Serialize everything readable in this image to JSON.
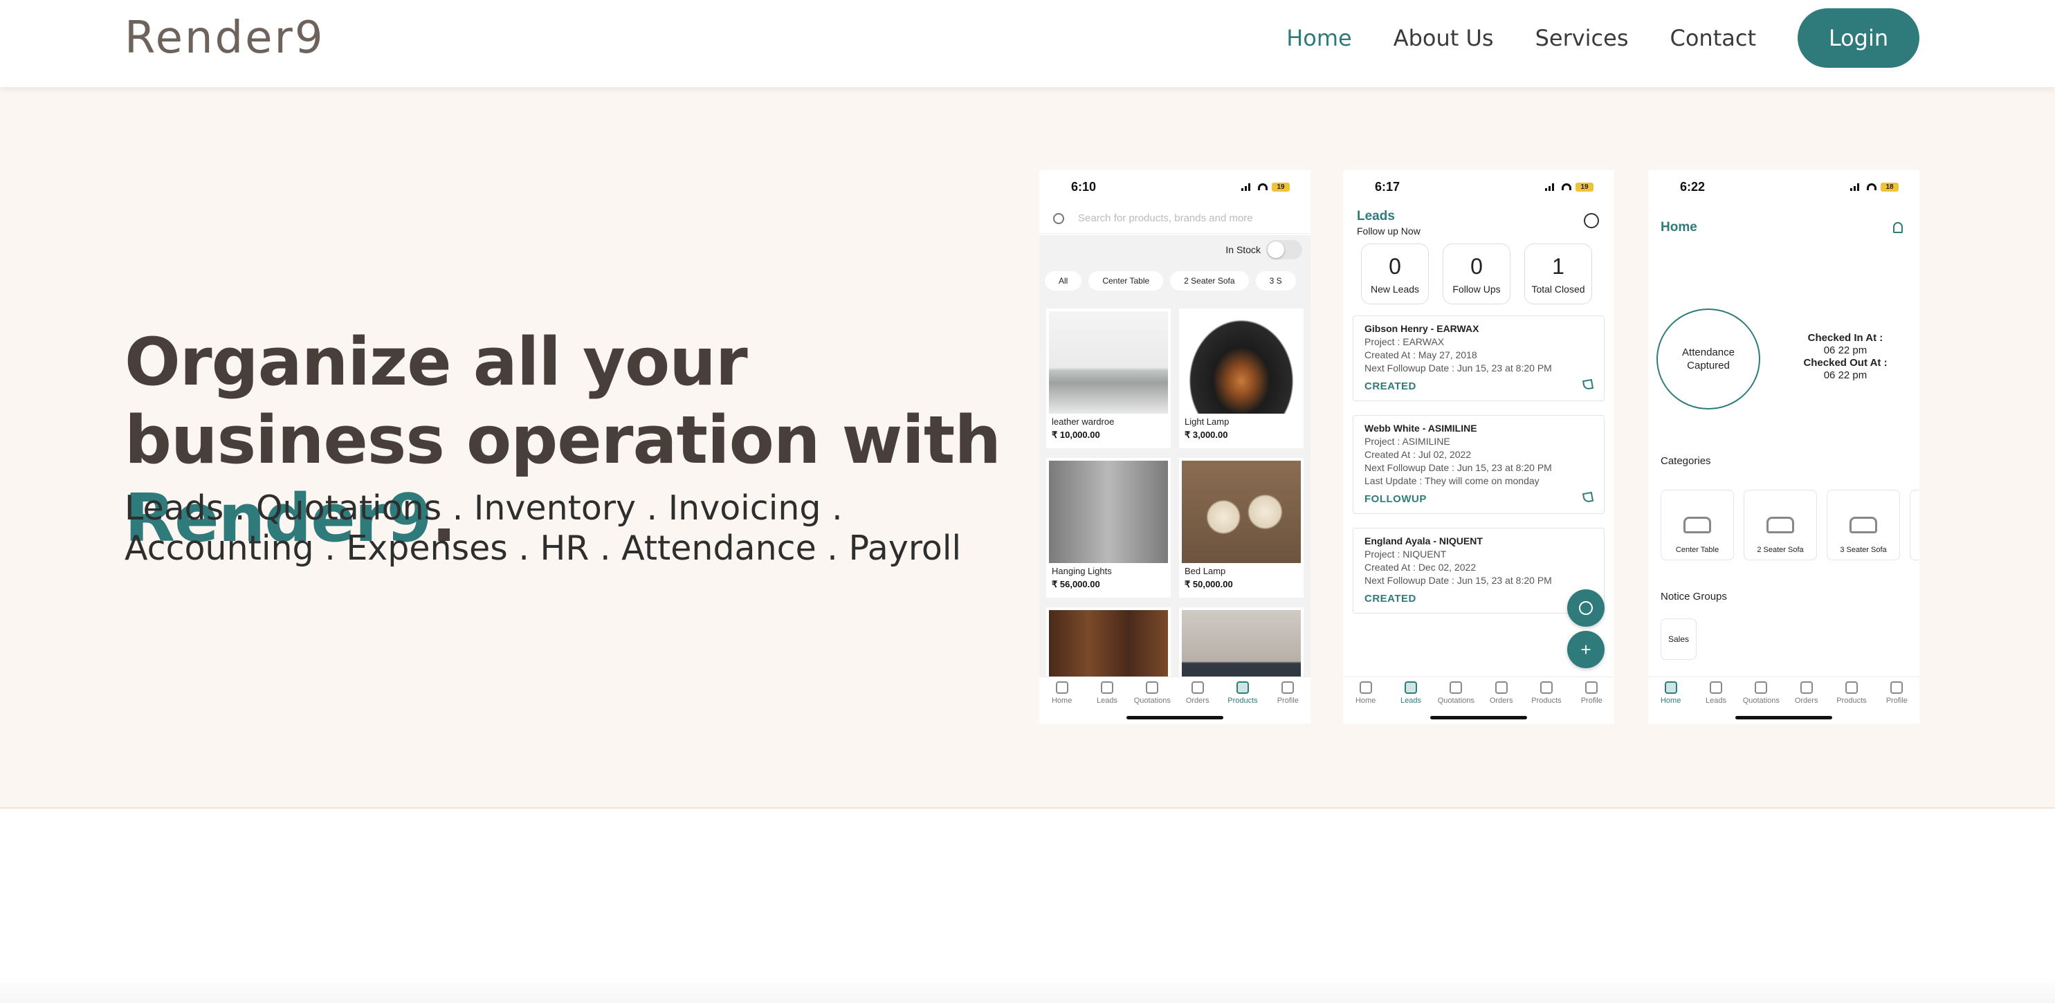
{
  "nav": {
    "logo": "Render9",
    "links": [
      "Home",
      "About Us",
      "Services",
      "Contact"
    ],
    "active": "Home",
    "login_label": "Login"
  },
  "hero": {
    "headline_part1": "Organize all your business operation with ",
    "headline_brand": "Render9",
    "headline_end": ".",
    "subline": "Leads . Quotations . Inventory . Invoicing . Accounting . Expenses . HR . Attendance . Payroll"
  },
  "colors": {
    "accent": "#2f7b7b",
    "hero_bg": "#fcf6f2",
    "heading": "#483f3a"
  },
  "tabs": [
    "Home",
    "Leads",
    "Quotations",
    "Orders",
    "Products",
    "Profile"
  ],
  "phone_products": {
    "time": "6:10",
    "battery": "19",
    "search_placeholder": "Search for products, brands and more",
    "in_stock_label": "In Stock",
    "chips": [
      "All",
      "Center Table",
      "2 Seater Sofa",
      "3 S"
    ],
    "products": [
      {
        "name": "leather wardroe",
        "price": "₹ 10,000.00"
      },
      {
        "name": "Light Lamp",
        "price": "₹ 3,000.00"
      },
      {
        "name": "Hanging Lights",
        "price": "₹ 56,000.00"
      },
      {
        "name": "Bed Lamp",
        "price": "₹ 50,000.00"
      }
    ],
    "active_tab": "Products"
  },
  "phone_leads": {
    "time": "6:17",
    "battery": "19",
    "title": "Leads",
    "subtitle": "Follow up Now",
    "stats": [
      {
        "value": "0",
        "label": "New Leads"
      },
      {
        "value": "0",
        "label": "Follow Ups"
      },
      {
        "value": "1",
        "label": "Total Closed"
      }
    ],
    "leads": [
      {
        "name": "Gibson Henry - EARWAX",
        "project": "Project : EARWAX",
        "created": "Created At : May 27, 2018",
        "next": "Next Followup Date : Jun 15, 23 at 8:20 PM",
        "update": "",
        "status": "CREATED"
      },
      {
        "name": "Webb White - ASIMILINE",
        "project": "Project : ASIMILINE",
        "created": "Created At : Jul 02, 2022",
        "next": "Next Followup Date : Jun 15, 23 at 8:20 PM",
        "update": "Last Update : They will come on monday",
        "status": "FOLLOWUP"
      },
      {
        "name": "England Ayala - NIQUENT",
        "project": "Project : NIQUENT",
        "created": "Created At : Dec 02, 2022",
        "next": "Next Followup Date : Jun 15, 23 at 8:20 PM",
        "update": "",
        "status": "CREATED"
      }
    ],
    "fab_add": "+",
    "active_tab": "Leads"
  },
  "phone_home": {
    "time": "6:22",
    "battery": "18",
    "title": "Home",
    "attendance": "Attendance Captured",
    "checked_in_label": "Checked In At :",
    "checked_in_time": "06 22 pm",
    "checked_out_label": "Checked Out At :",
    "checked_out_time": "06 22 pm",
    "categories_label": "Categories",
    "categories": [
      "Center Table",
      "2 Seater Sofa",
      "3 Seater Sofa"
    ],
    "notice_label": "Notice Groups",
    "notice_groups": [
      "Sales"
    ],
    "active_tab": "Home"
  }
}
